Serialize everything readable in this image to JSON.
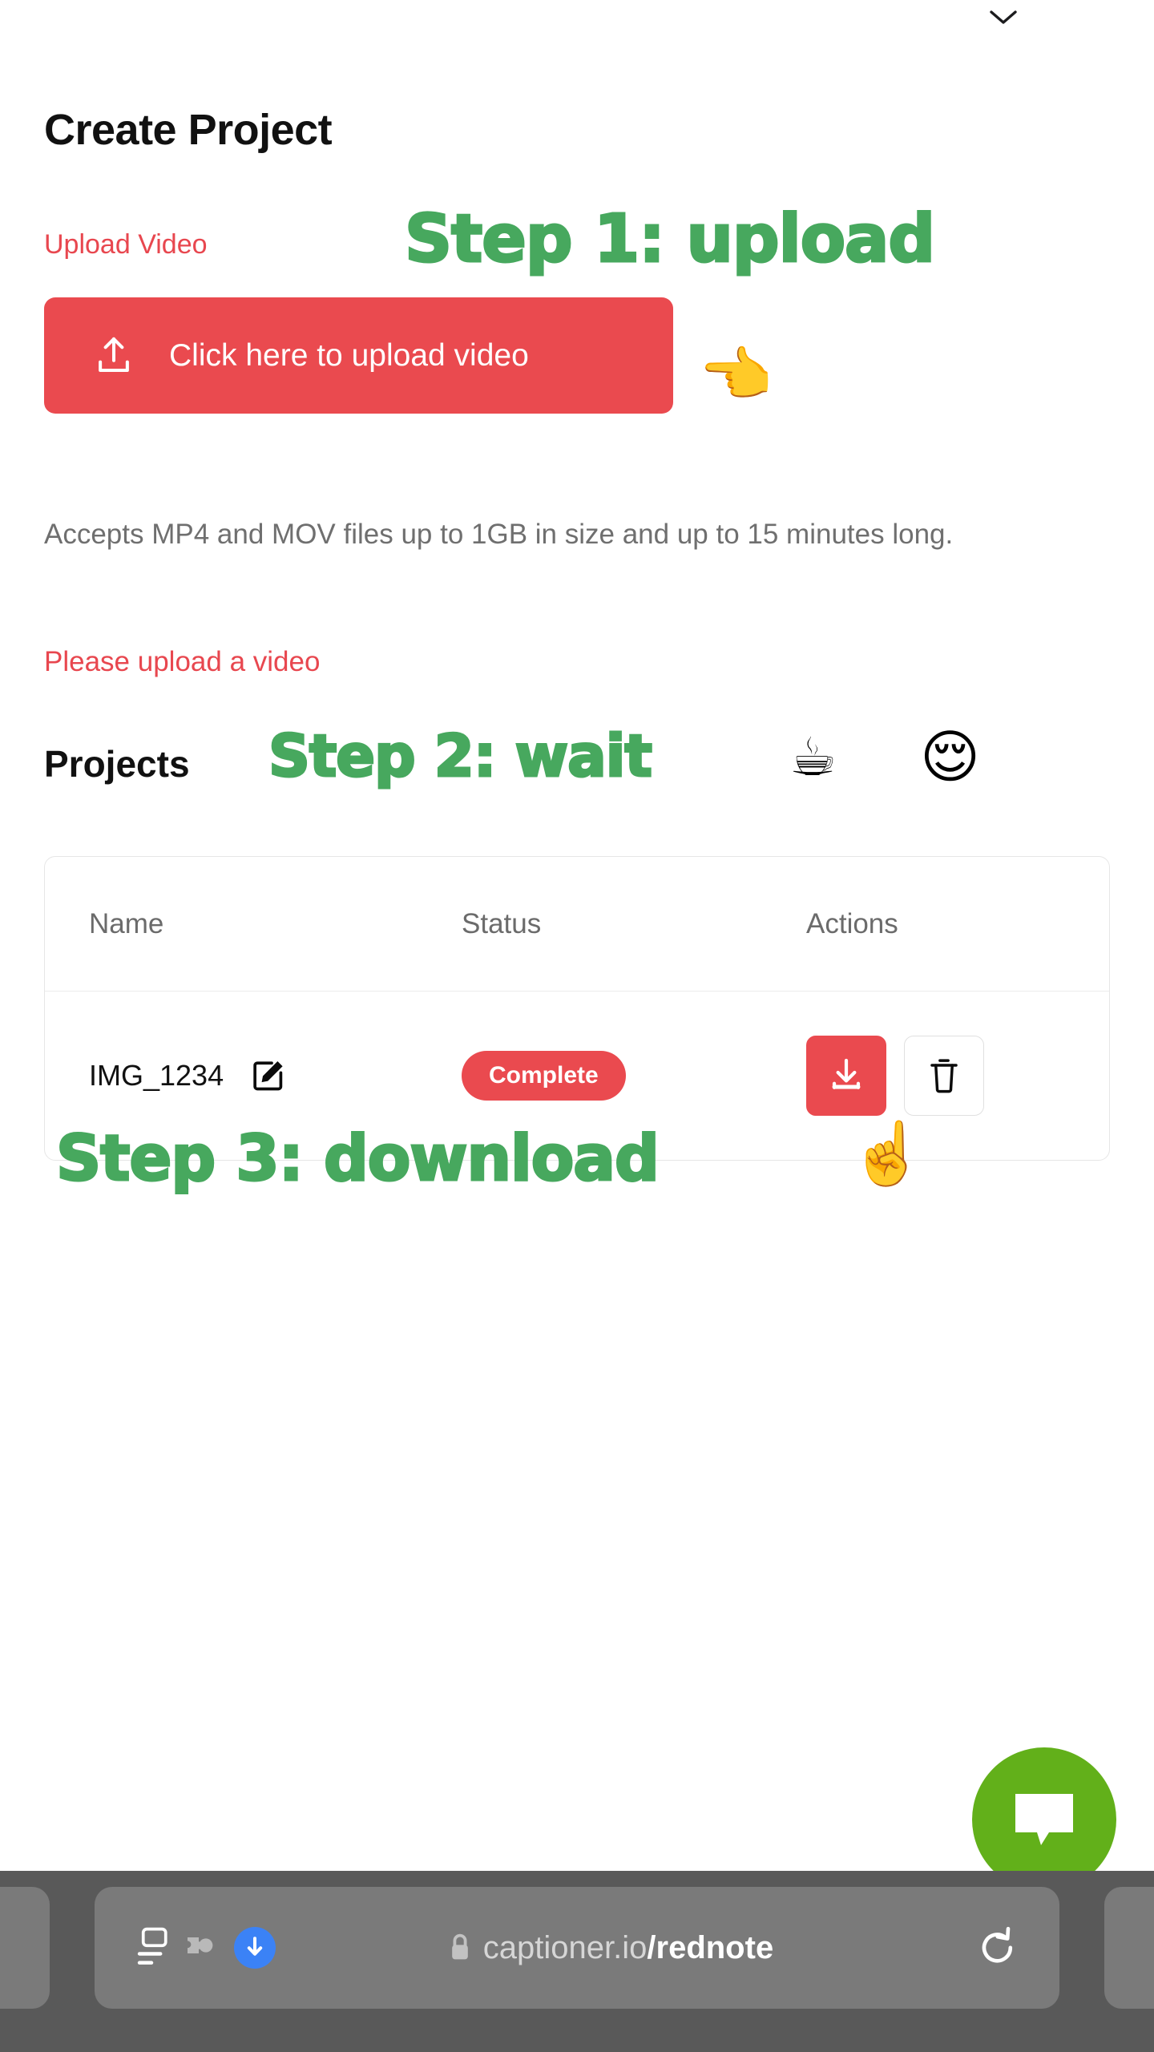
{
  "browser": {
    "chevron_icon": "chevron-down-icon",
    "url_domain": "captioner.io",
    "url_path": "/rednote",
    "lock_icon": "lock-icon",
    "reader_icon": "reader-view-icon",
    "extensions_icon": "puzzle-extension-icon",
    "download_icon": "download-indicator-icon",
    "reload_icon": "reload-icon"
  },
  "page": {
    "title": "Create Project",
    "upload_section": {
      "label": "Upload Video",
      "button_label": "Click here to upload video",
      "button_icon": "upload-icon",
      "helper_text": "Accepts MP4 and MOV files up to 1GB in size and up to 15 minutes long.",
      "error_text": "Please upload a video"
    },
    "projects_section": {
      "title": "Projects",
      "columns": [
        "Name",
        "Status",
        "Actions"
      ],
      "rows": [
        {
          "name": "IMG_1234",
          "edit_icon": "edit-pencil-icon",
          "status": "Complete",
          "download_icon": "download-icon",
          "delete_icon": "trash-icon"
        }
      ]
    },
    "chat_widget": {
      "icon": "chat-bubble-icon"
    }
  },
  "annotations": [
    {
      "text": "Step 1: upload",
      "emoji": "👈"
    },
    {
      "text": "Step 2: wait",
      "emoji": "☕",
      "emoji2": "😌"
    },
    {
      "text": "Step 3: download",
      "emoji": "☝️"
    }
  ],
  "colors": {
    "red": "#ea4a4f",
    "green_annotation": "#47a85e",
    "chat_green": "#62b01a",
    "text_dark": "#111111",
    "text_muted": "#6f6f6f",
    "bar_grey": "#595959"
  }
}
